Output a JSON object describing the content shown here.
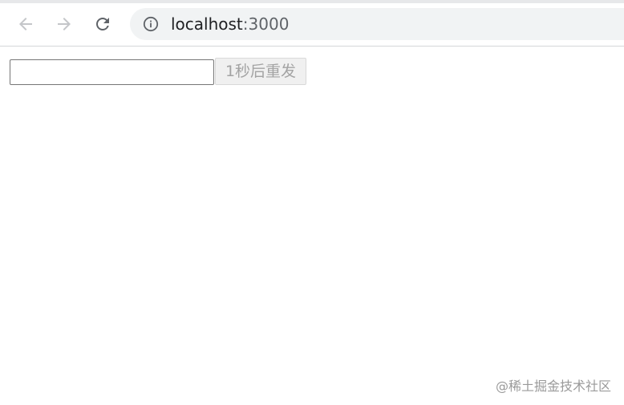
{
  "browser": {
    "url_host": "localhost",
    "url_port": ":3000",
    "icons": {
      "back": "arrow-left-icon",
      "forward": "arrow-right-icon",
      "reload": "reload-icon",
      "site_info": "info-icon"
    },
    "colors": {
      "omnibox_bg": "#f1f3f4",
      "nav_disabled": "#a8abaf",
      "nav_enabled": "#5f6368"
    }
  },
  "page": {
    "code_input_value": "",
    "resend_button_label": "1秒后重发",
    "resend_button_disabled": true
  },
  "watermark": "@稀土掘金技术社区"
}
